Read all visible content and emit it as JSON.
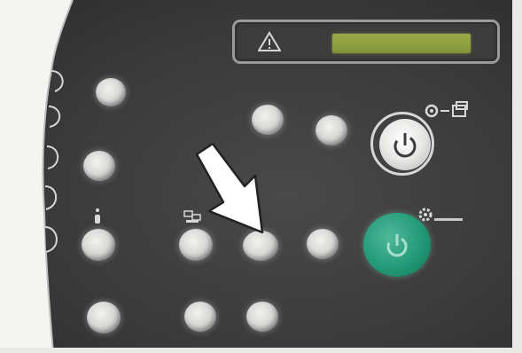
{
  "panel": {
    "colors": {
      "body": "#3c3b3b",
      "lcd": "#8ea040",
      "button": "#d9d8d6",
      "start": "#239a78",
      "arrow": "#ffffff"
    },
    "lcd": {
      "warning_icon": "warning-triangle-icon"
    },
    "side_tabs": {
      "labels": [
        "",
        "",
        "",
        "",
        ""
      ]
    },
    "icons": {
      "power": "power-icon",
      "start": "start-icon",
      "key_ready": "key-ready-icon",
      "settings": "gear-icon",
      "indicator_a": "info-icon",
      "indicator_b": "copies-icon"
    },
    "arrow": "pointer-arrow-icon"
  }
}
